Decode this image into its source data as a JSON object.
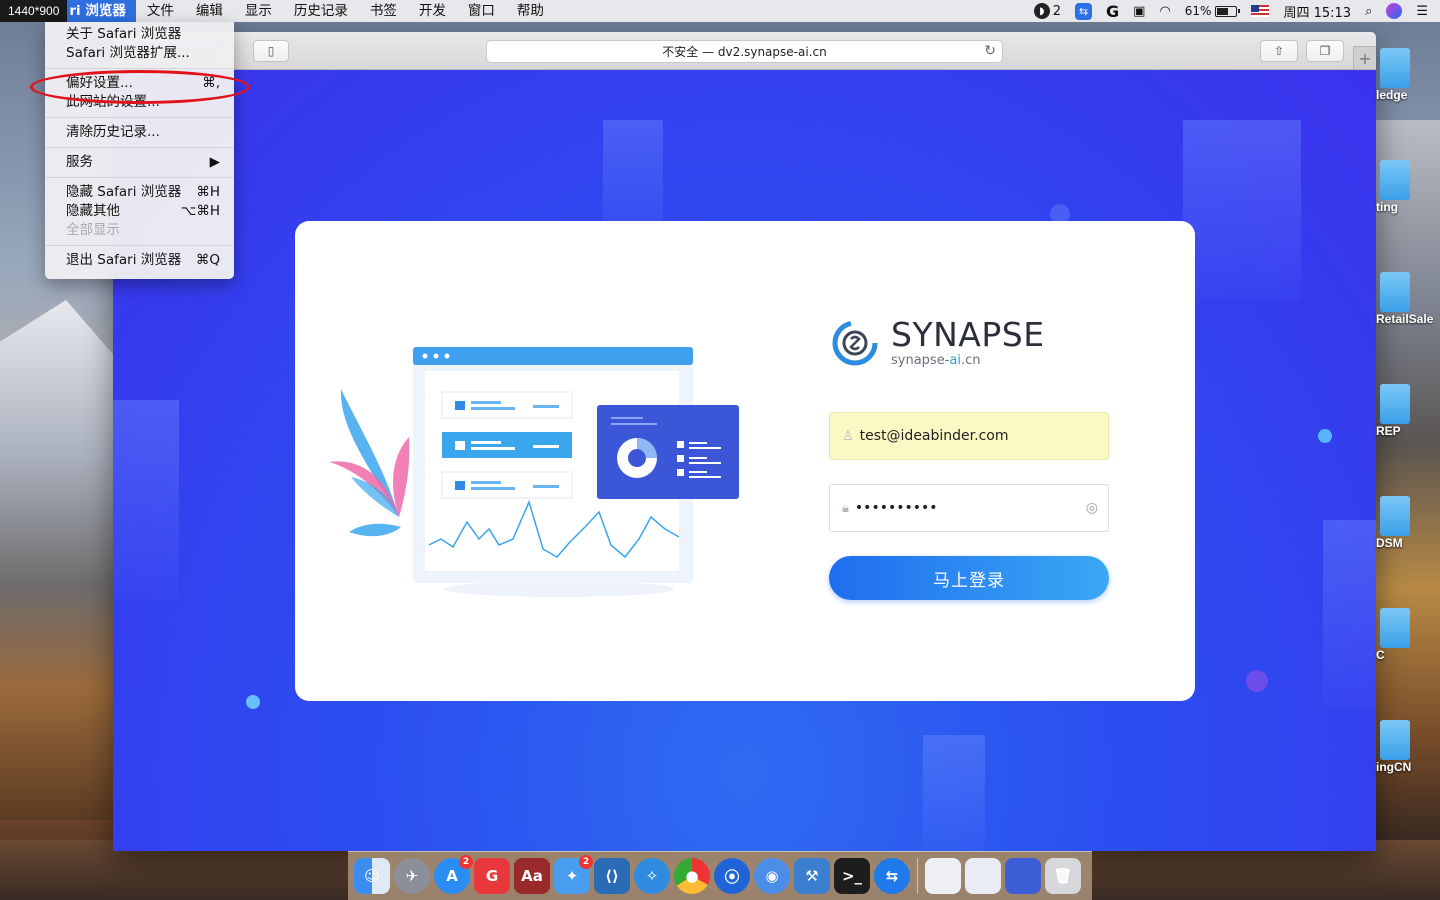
{
  "menubar": {
    "resolution_badge": "1440*900",
    "app_name": "ri 浏览器",
    "items": [
      "文件",
      "编辑",
      "显示",
      "历史记录",
      "书签",
      "开发",
      "窗口",
      "帮助"
    ],
    "status": {
      "notif_count": "2",
      "battery": "61%",
      "battery_level": 0.61,
      "datetime": "周四 15:13"
    }
  },
  "dropdown": {
    "items": [
      {
        "label": "关于 Safari 浏览器",
        "shortcut": ""
      },
      {
        "label": "Safari 浏览器扩展...",
        "shortcut": ""
      },
      {
        "label": "偏好设置...",
        "shortcut": "⌘,"
      },
      {
        "label": "此网站的设置...",
        "shortcut": ""
      },
      {
        "label": "清除历史记录...",
        "shortcut": ""
      },
      {
        "label": "服务",
        "shortcut": "▶"
      },
      {
        "label": "隐藏 Safari 浏览器",
        "shortcut": "⌘H"
      },
      {
        "label": "隐藏其他",
        "shortcut": "⌥⌘H"
      },
      {
        "label": "全部显示",
        "shortcut": ""
      },
      {
        "label": "退出 Safari 浏览器",
        "shortcut": "⌘Q"
      }
    ]
  },
  "browser": {
    "address": "不安全 — dv2.synapse-ai.cn"
  },
  "login": {
    "brand": "SYNAPSE",
    "domain_prefix": "synapse-",
    "domain_highlight": "ai",
    "domain_suffix": ".cn",
    "email_value": "test@ideabinder.com",
    "password_value": "••••••••••",
    "submit_label": "马上登录"
  },
  "desktop": {
    "labels": [
      "ledge",
      "ting",
      "RetailSale",
      "REP",
      "DSM",
      "C",
      "ingCN"
    ]
  },
  "colors": {
    "page_bg": "#3b32ee",
    "button": "#1f6df0",
    "menu_highlight": "#2f6fe0",
    "annotation": "#e0121a"
  }
}
